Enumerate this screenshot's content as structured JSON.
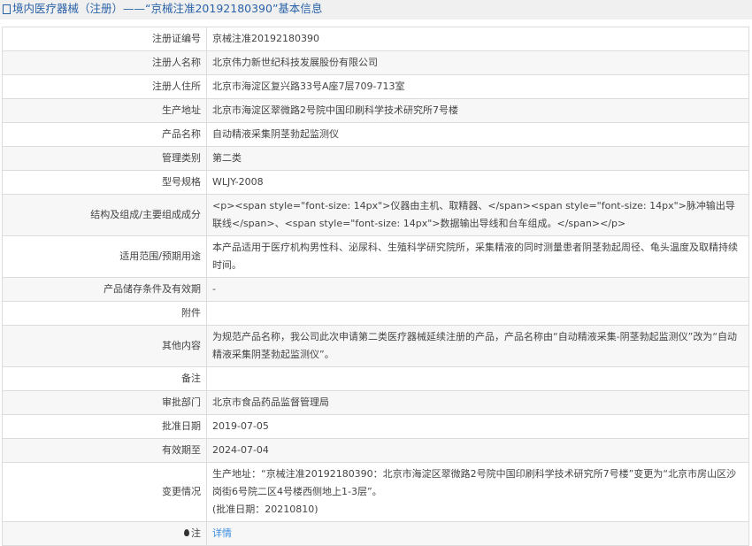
{
  "header": {
    "title": "境内医疗器械（注册）——“京械注准20192180390”基本信息"
  },
  "rows": [
    {
      "label": "注册证编号",
      "value": "京械注准20192180390"
    },
    {
      "label": "注册人名称",
      "value": "北京伟力新世纪科技发展股份有限公司"
    },
    {
      "label": "注册人住所",
      "value": "北京市海淀区复兴路33号A座7层709-713室"
    },
    {
      "label": "生产地址",
      "value": "北京市海淀区翠微路2号院中国印刷科学技术研究所7号楼"
    },
    {
      "label": "产品名称",
      "value": "自动精液采集阴茎勃起监测仪"
    },
    {
      "label": "管理类别",
      "value": "第二类"
    },
    {
      "label": "型号规格",
      "value": "WLJY-2008"
    },
    {
      "label": "结构及组成/主要组成成分",
      "value": "<p><span style=\"font-size: 14px\">仪器由主机、取精器、</span><span style=\"font-size: 14px\">脉冲输出导联线</span>、<span style=\"font-size: 14px\">数据输出导线和台车组成。</span></p>"
    },
    {
      "label": "适用范围/预期用途",
      "value": "本产品适用于医疗机构男性科、泌尿科、生殖科学研究院所，采集精液的同时测量患者阴茎勃起周径、龟头温度及取精持续时间。"
    },
    {
      "label": "产品储存条件及有效期",
      "value": "-"
    },
    {
      "label": "附件",
      "value": ""
    },
    {
      "label": "其他内容",
      "value": "为规范产品名称，我公司此次申请第二类医疗器械延续注册的产品，产品名称由“自动精液采集-阴茎勃起监测仪”改为“自动精液采集阴茎勃起监测仪”。"
    },
    {
      "label": "备注",
      "value": ""
    },
    {
      "label": "审批部门",
      "value": "北京市食品药品监督管理局"
    },
    {
      "label": "批准日期",
      "value": "2019-07-05"
    },
    {
      "label": "有效期至",
      "value": "2024-07-04"
    }
  ],
  "change": {
    "label": "变更情况",
    "line1": "生产地址：“京械注准20192180390：北京市海淀区翠微路2号院中国印刷科学技术研究所7号楼”变更为“北京市房山区沙岗街6号院二区4号楼西侧地上1-3层”。",
    "line2": "(批准日期：20210810)"
  },
  "note": {
    "label": "注",
    "link": "详情"
  }
}
